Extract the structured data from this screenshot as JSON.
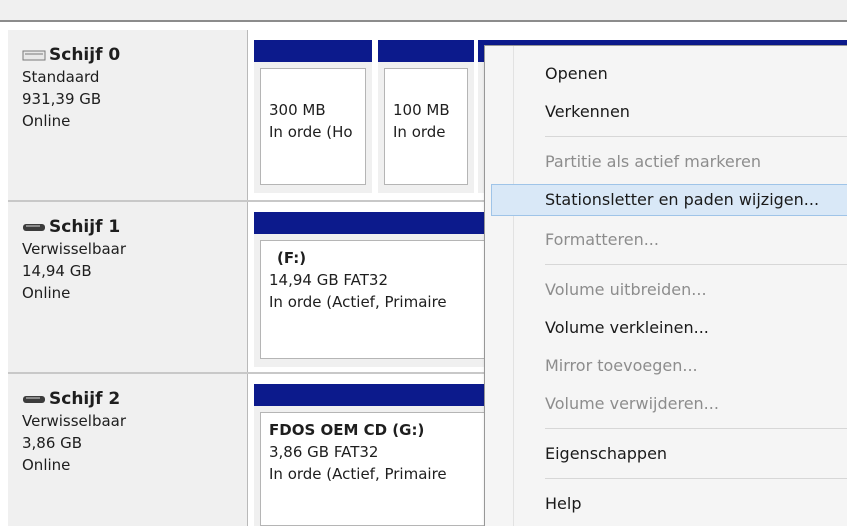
{
  "disks": [
    {
      "name": "Schijf 0",
      "type": "Standaard",
      "size": "931,39 GB",
      "status": "Online",
      "icon": "hard-disk-icon"
    },
    {
      "name": "Schijf 1",
      "type": "Verwisselbaar",
      "size": "14,94 GB",
      "status": "Online",
      "icon": "removable-disk-icon"
    },
    {
      "name": "Schijf 2",
      "type": "Verwisselbaar",
      "size": "3,86 GB",
      "status": "Online",
      "icon": "removable-disk-icon"
    }
  ],
  "partitions": {
    "disk0_p1": {
      "size": "300 MB",
      "status": "In orde (Ho"
    },
    "disk0_p2": {
      "size": "100 MB",
      "status": "In orde"
    },
    "disk1_p1": {
      "label": "(F:)",
      "size": "14,94 GB FAT32",
      "status": "In orde (Actief, Primaire"
    },
    "disk2_p1": {
      "label": "FDOS OEM CD  (G:)",
      "size": "3,86 GB FAT32",
      "status": "In orde (Actief, Primaire"
    }
  },
  "context_menu": {
    "items": [
      {
        "label": "Openen",
        "enabled": true
      },
      {
        "label": "Verkennen",
        "enabled": true
      },
      {
        "label": "Partitie als actief markeren",
        "enabled": false
      },
      {
        "label": "Stationsletter en paden wijzigen...",
        "enabled": true,
        "highlighted": true
      },
      {
        "label": "Formatteren...",
        "enabled": false
      },
      {
        "label": "Volume uitbreiden...",
        "enabled": false
      },
      {
        "label": "Volume verkleinen...",
        "enabled": true
      },
      {
        "label": "Mirror toevoegen...",
        "enabled": false
      },
      {
        "label": "Volume verwijderen...",
        "enabled": false
      },
      {
        "label": "Eigenschappen",
        "enabled": true
      },
      {
        "label": "Help",
        "enabled": true
      }
    ]
  },
  "colors": {
    "partition_bar": "#0c1a8c",
    "menu_highlight": "#d9e8f7",
    "disabled_text": "#8d8d8d"
  }
}
